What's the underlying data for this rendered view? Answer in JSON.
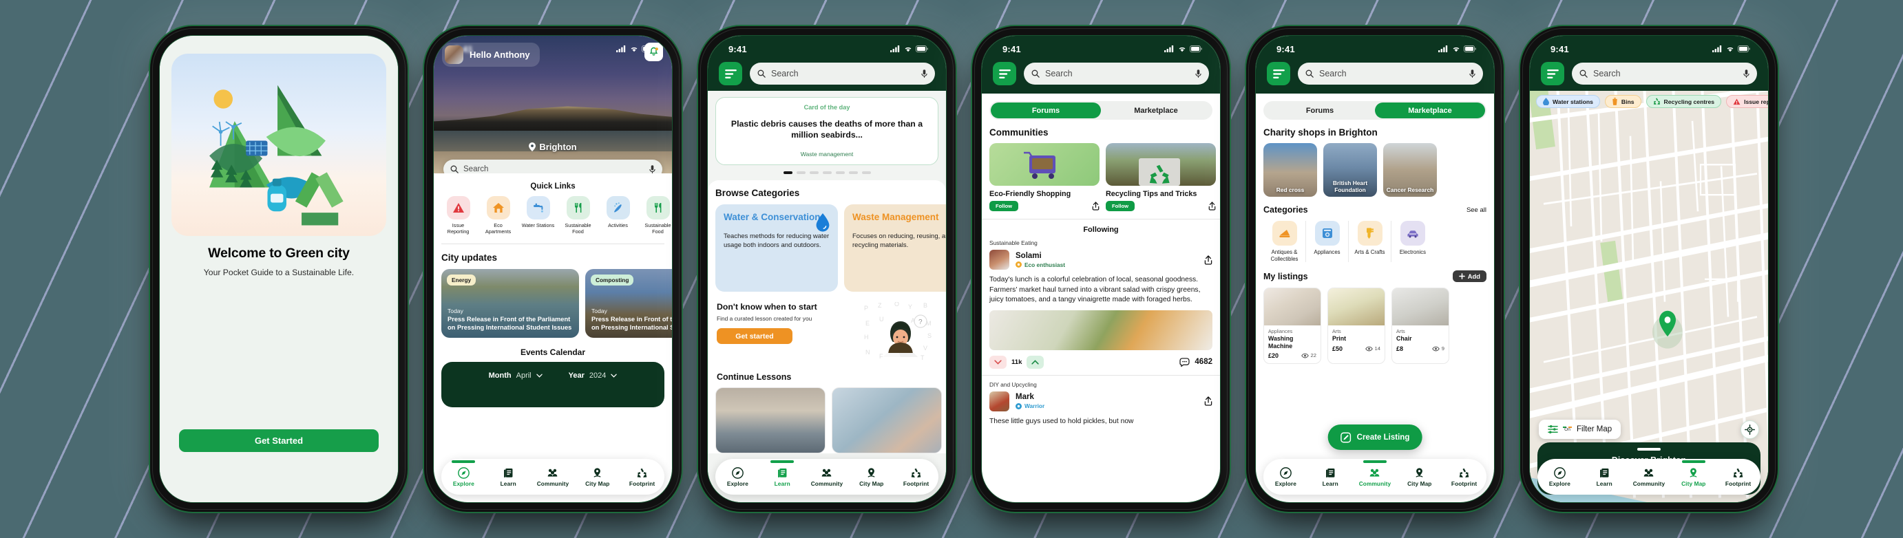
{
  "background": {
    "color": "#4b6a71",
    "stripe_color": "#b0b4dc"
  },
  "theme": {
    "dark_green": "#0c3520",
    "green": "#0f9b45",
    "orange": "#ee9223",
    "blue": "#3d8fd6"
  },
  "status_bar": {
    "time": "9:41"
  },
  "common": {
    "search_placeholder": "Search",
    "nav": [
      {
        "label": "Explore",
        "icon": "compass-icon"
      },
      {
        "label": "Learn",
        "icon": "book-icon"
      },
      {
        "label": "Community",
        "icon": "people-icon"
      },
      {
        "label": "City Map",
        "icon": "map-pin-icon"
      },
      {
        "label": "Footprint",
        "icon": "recycle-icon"
      }
    ]
  },
  "screens": [
    {
      "id": "onboarding",
      "title": "Welcome to Green city",
      "subtitle": "Your Pocket Guide to a Sustainable Life.",
      "cta": "Get Started"
    },
    {
      "id": "explore",
      "greeting": "Hello Anthony",
      "location": "Brighton",
      "quick_links_title": "Quick Links",
      "quick_links": [
        {
          "label": "Issue Reporting",
          "icon": "warning-triangle-icon",
          "bg": "#fadfe0",
          "fg": "#e0393f"
        },
        {
          "label": "Eco Apartments",
          "icon": "home-icon",
          "bg": "#fbe6cb",
          "fg": "#ef9425"
        },
        {
          "label": "Water Stations",
          "icon": "faucet-icon",
          "bg": "#d9e8f7",
          "fg": "#3d8fd6"
        },
        {
          "label": "Sustainable Food",
          "icon": "cutlery-icon",
          "bg": "#ddf0e2",
          "fg": "#169e4a"
        },
        {
          "label": "Activities",
          "icon": "activities-icon",
          "bg": "#d6e7f4",
          "fg": "#3d8fd6"
        },
        {
          "label": "Sustainable Food",
          "icon": "cutlery-icon",
          "bg": "#ddf0e2",
          "fg": "#169e4a"
        }
      ],
      "city_updates_title": "City updates",
      "news": [
        {
          "tag": "Energy",
          "tag_bg": "#f6eec9",
          "day": "Today",
          "headline": "Press Release in Front of the Parliament on Pressing International Student Issues"
        },
        {
          "tag": "Composting",
          "tag_bg": "#cdeed8",
          "day": "Today",
          "headline": "Press Release in Front of the Parliament on Pressing International Student Issues"
        }
      ],
      "events_title": "Events Calendar",
      "month_label": "Month",
      "month_value": "April",
      "year_label": "Year",
      "year_value": "2024",
      "active_nav": "Explore"
    },
    {
      "id": "learn",
      "card_of_day_kicker": "Card of the day",
      "card_of_day_headline": "Plastic debris causes the deaths of more than a million seabirds...",
      "card_of_day_footer": "Waste management",
      "carousel_dots": 7,
      "carousel_active": 1,
      "browse_title": "Browse Categories",
      "categories": [
        {
          "title": "Water & Conservation",
          "desc": "Teaches methods for reducing water usage both indoors and outdoors.",
          "icon": "water-drop-icon"
        },
        {
          "title": "Waste Management",
          "desc": "Focuses on reducing, reusing, and recycling materials.",
          "icon": "waste-icon"
        }
      ],
      "start_title": "Don't know when to start",
      "start_sub": "Find a curated lesson created for you",
      "start_cta": "Get started",
      "continue_title": "Continue Lessons",
      "active_nav": "Learn"
    },
    {
      "id": "community-forums",
      "tabs": [
        {
          "label": "Forums",
          "active": true
        },
        {
          "label": "Marketplace",
          "active": false
        }
      ],
      "communities_title": "Communities",
      "communities": [
        {
          "name": "Eco-Friendly Shopping",
          "follow": "Follow"
        },
        {
          "name": "Recycling Tips and Tricks",
          "follow": "Follow"
        }
      ],
      "following_title": "Following",
      "posts": [
        {
          "topic": "Sustainable Eating",
          "author": "Solami",
          "badge": "Eco enthusiast",
          "badge_color": "#2f7f50",
          "badge_icon_color": "#f0a92a",
          "text": "Today's lunch is a colorful celebration of local, seasonal goodness. Farmers' market haul turned into a vibrant salad with crispy greens, juicy tomatoes, and a tangy vinaigrette made with foraged herbs.",
          "votes": "11k",
          "comments": "4682"
        },
        {
          "topic": "DIY and Upcycling",
          "author": "Mark",
          "badge": "Warrior",
          "badge_color": "#2f9bd0",
          "badge_icon_color": "#2f9bd0",
          "text": "These little guys used to hold pickles, but now"
        }
      ],
      "active_nav": "Community"
    },
    {
      "id": "community-marketplace",
      "tabs": [
        {
          "label": "Forums",
          "active": false
        },
        {
          "label": "Marketplace",
          "active": true
        }
      ],
      "shops_title": "Charity shops in Brighton",
      "shops": [
        {
          "name": "Red cross"
        },
        {
          "name": "British Heart Foundation"
        },
        {
          "name": "Cancer Research"
        }
      ],
      "categories_title": "Categories",
      "see_all": "See all",
      "categories": [
        {
          "label": "Antiques & Collectibles",
          "icon": "antiques-icon",
          "bg": "#fbeacf",
          "fg": "#ef9425"
        },
        {
          "label": "Appliances",
          "icon": "appliance-icon",
          "bg": "#d7e7f6",
          "fg": "#3d8fd6"
        },
        {
          "label": "Arts & Crafts",
          "icon": "paintbrush-icon",
          "bg": "#fbeacf",
          "fg": "#f0b429"
        },
        {
          "label": "Electronics",
          "icon": "car-icon",
          "bg": "#e4e0f2",
          "fg": "#7b6ec6"
        }
      ],
      "listings_title": "My listings",
      "add_label": "Add",
      "listings": [
        {
          "category": "Appliances",
          "name": "Washing Machine",
          "price": "£20",
          "views": "22"
        },
        {
          "category": "Arts",
          "name": "Print",
          "price": "£50",
          "views": "14"
        },
        {
          "category": "Arts",
          "name": "Chair",
          "price": "£8",
          "views": "9"
        }
      ],
      "fab": "Create Listing",
      "active_nav": "Community"
    },
    {
      "id": "city-map",
      "filters": [
        {
          "label": "Water stations",
          "icon": "water-drop-icon",
          "style": "blue"
        },
        {
          "label": "Bins",
          "icon": "bin-icon",
          "style": "orange"
        },
        {
          "label": "Recycling centres",
          "icon": "recycle-icon",
          "style": "green"
        },
        {
          "label": "Issue reporting",
          "icon": "warning-triangle-icon",
          "style": "red"
        }
      ],
      "filter_map": "Filter Map",
      "filter_state": "On",
      "sheet_title": "Discover Brighton",
      "active_nav": "City Map"
    }
  ]
}
